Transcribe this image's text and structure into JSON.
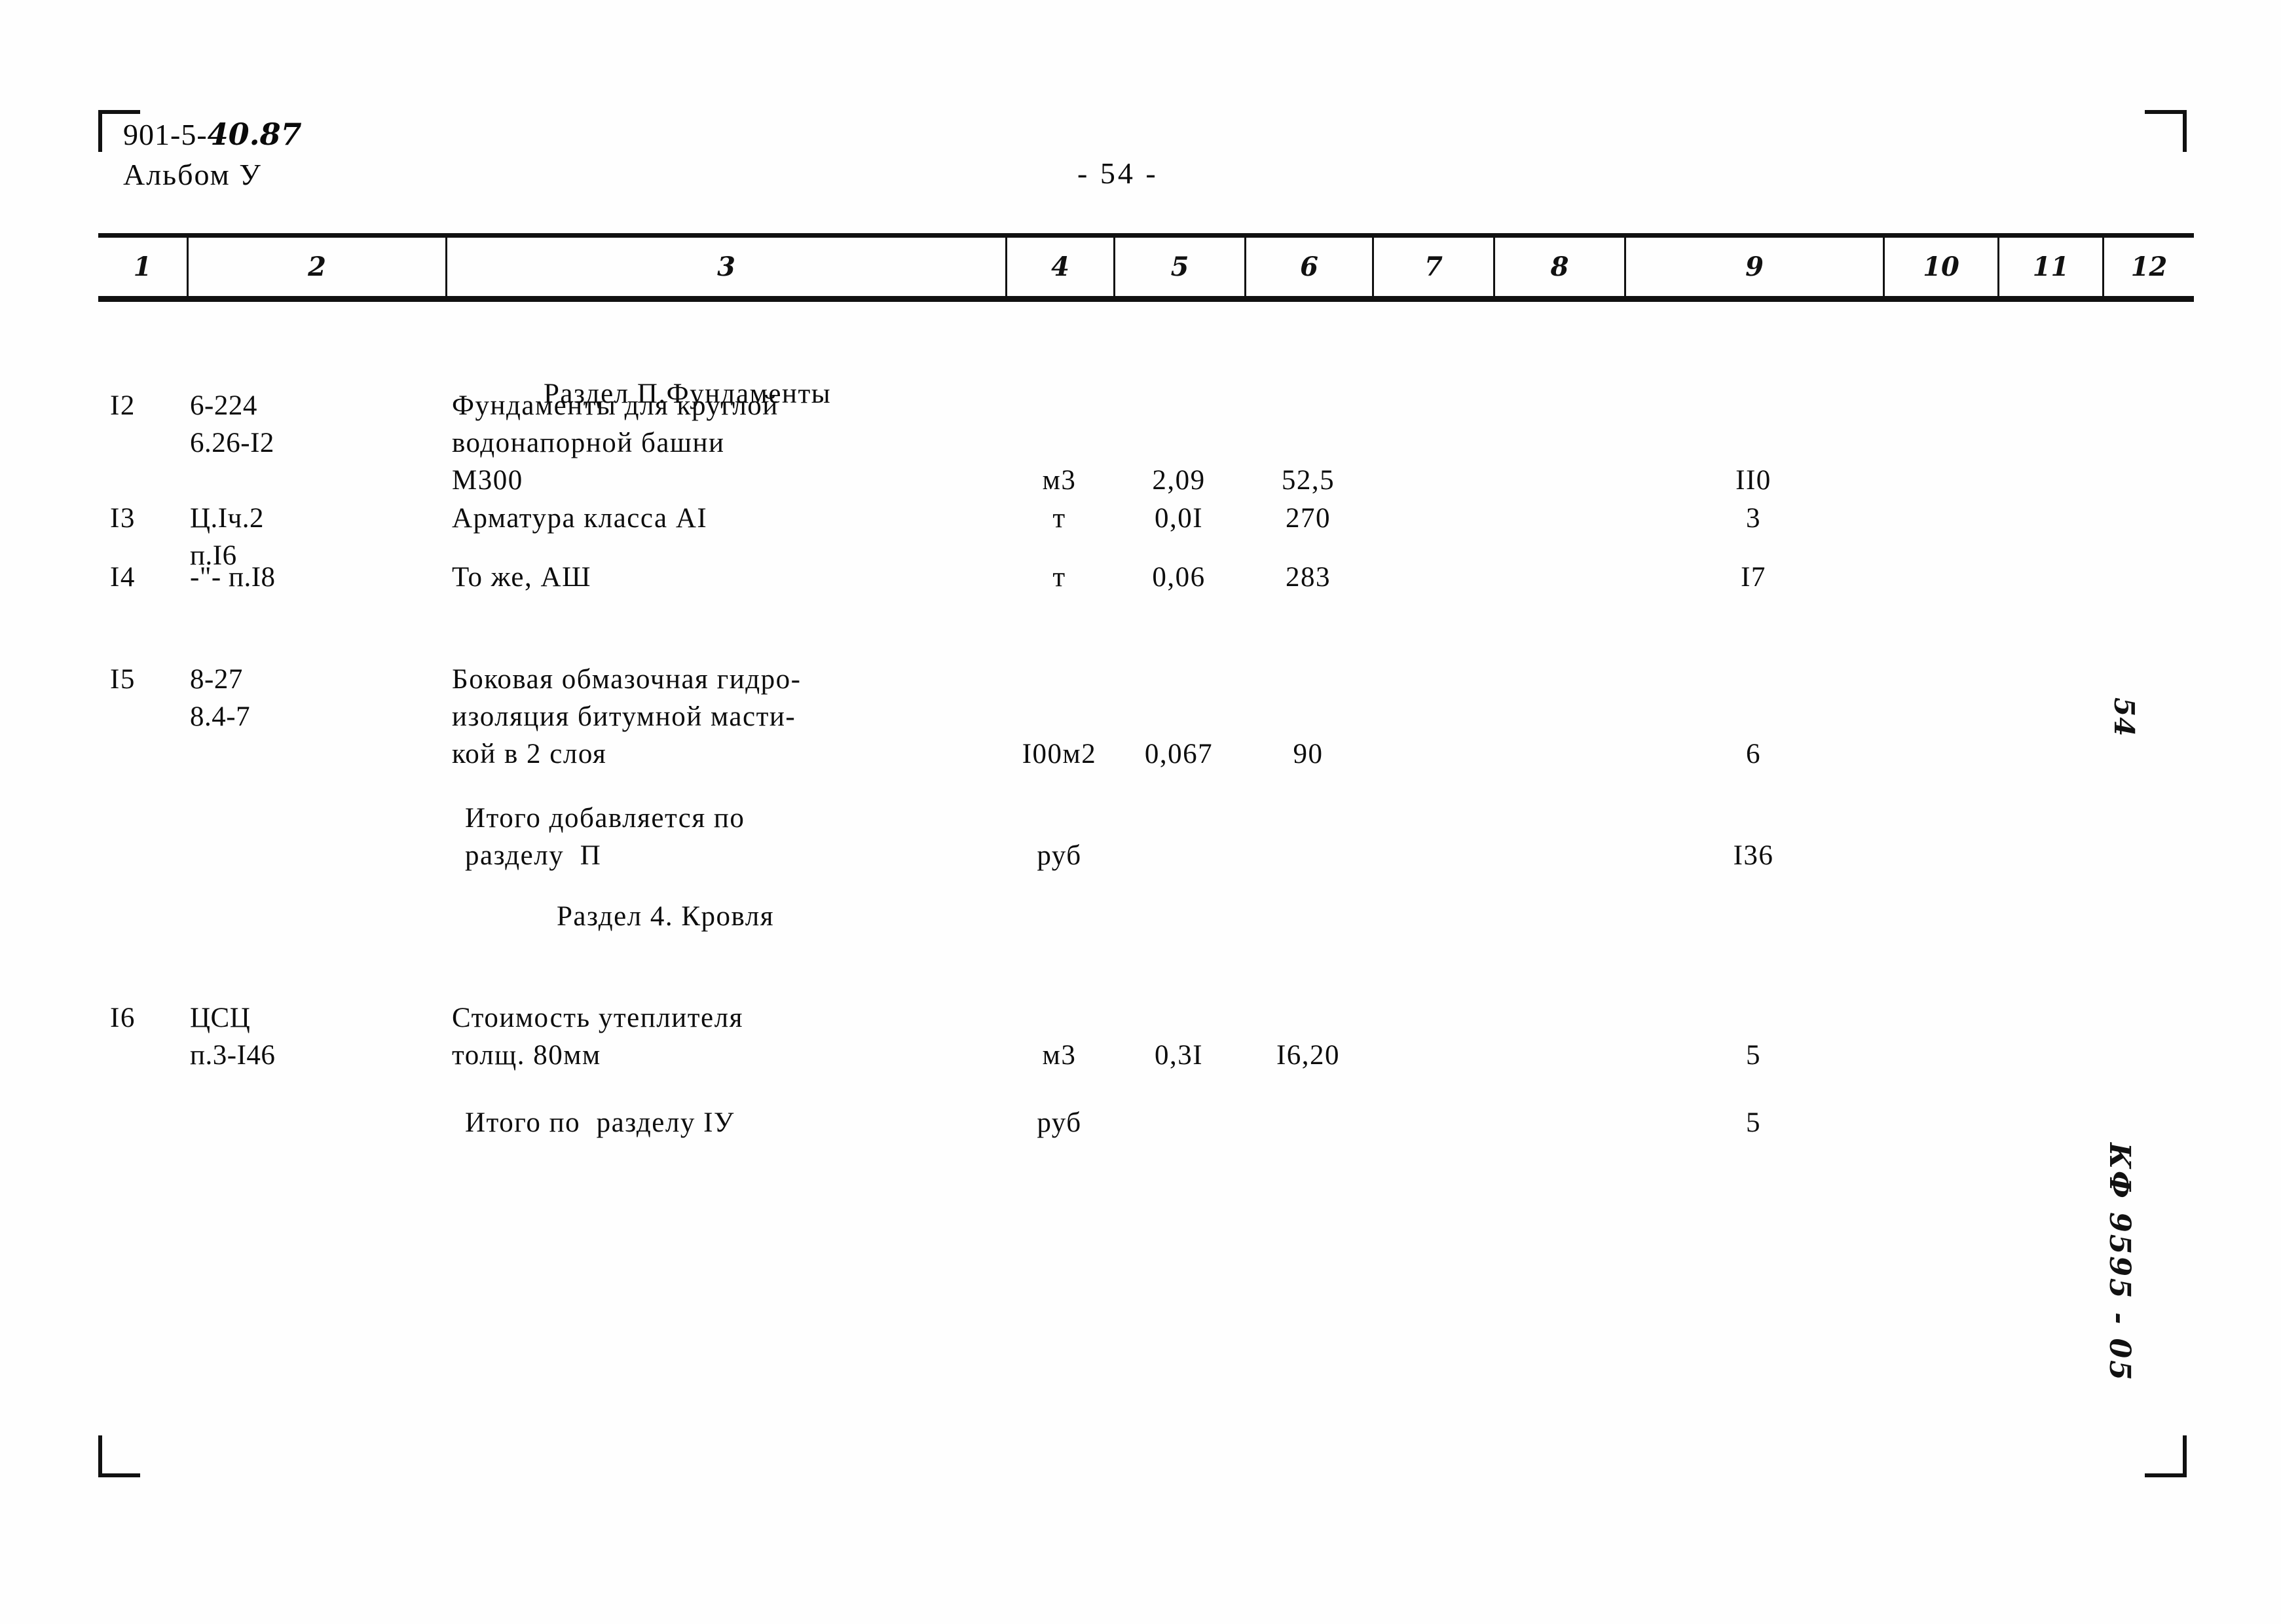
{
  "header": {
    "doc_code_prefix": "901-5-",
    "doc_code_hand": "40.87",
    "album": "Альбом У",
    "page_number": "- 54 -"
  },
  "margin_notes": {
    "page_number_hand": "54",
    "archive_code": "КФ 9595 - 05"
  },
  "table": {
    "column_headers": [
      "1",
      "2",
      "3",
      "4",
      "5",
      "6",
      "7",
      "8",
      "9",
      "10",
      "11",
      "12"
    ],
    "rows": [
      {
        "kind": "section-title",
        "col3": "Раздел П.Фундаменты"
      },
      {
        "kind": "item",
        "col1": "I2",
        "col2": "6-224\n6.26-I2",
        "col3": "Фундаменты для круглой\nводонапорной башни\nМ300",
        "col4": "м3",
        "col5": "2,09",
        "col6": "52,5",
        "col9": "II0"
      },
      {
        "kind": "item",
        "col1": "I3",
        "col2": "Ц.Iч.2\nп.I6",
        "col3": "Арматура класса АI",
        "col4": "т",
        "col5": "0,0I",
        "col6": "270",
        "col9": "3"
      },
      {
        "kind": "item",
        "col1": "I4",
        "col2": "-\"- п.I8",
        "col3": "То же, АШ",
        "col4": "т",
        "col5": "0,06",
        "col6": "283",
        "col9": "I7"
      },
      {
        "kind": "item",
        "col1": "I5",
        "col2": "8-27\n8.4-7",
        "col3": "Боковая обмазочная гидро-\nизоляция битумной масти-\nкой в 2 слоя",
        "col4": "I00м2",
        "col5": "0,067",
        "col6": "90",
        "col9": "6"
      },
      {
        "kind": "subtotal",
        "col3": "Итого добавляется по\nразделу  П",
        "col4": "руб",
        "col9": "I36"
      },
      {
        "kind": "section-title",
        "col3": "Раздел 4. Кровля"
      },
      {
        "kind": "item",
        "col1": "I6",
        "col2": "ЦСЦ\nп.3-I46",
        "col3": "Стоимость утеплителя\nтолщ. 80мм",
        "col4": "м3",
        "col5": "0,3I",
        "col6": "I6,20",
        "col9": "5"
      },
      {
        "kind": "subtotal",
        "col3": "Итого по  разделу IУ",
        "col4": "руб",
        "col9": "5"
      }
    ]
  }
}
